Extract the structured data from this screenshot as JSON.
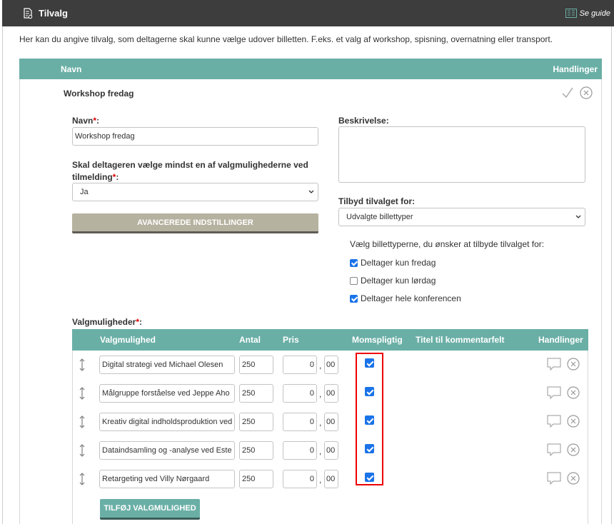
{
  "header": {
    "title": "Tilvalg",
    "guide_label": "Se guide"
  },
  "intro": "Her kan du angive tilvalg, som deltagerne skal kunne vælge udover billetten. F.eks. et valg af workshop, spisning, overnatning eller transport.",
  "table": {
    "col_name": "Navn",
    "col_actions": "Handlinger"
  },
  "item": {
    "title": "Workshop fredag",
    "name_label": "Navn",
    "name_value": "Workshop fredag",
    "required_mark": "*",
    "mandatory_label": "Skal deltageren vælge mindst en af valgmulighederne ved tilmelding",
    "mandatory_value": "Ja",
    "advanced_button": "AVANCEREDE INDSTILLINGER",
    "description_label": "Beskrivelse:",
    "offer_label": "Tilbyd tilvalget for:",
    "offer_value": "Udvalgte billettyper",
    "ticket_hint": "Vælg billettyperne, du ønsker at tilbyde tilvalget for:",
    "ticket_types": [
      {
        "label": "Deltager kun fredag",
        "checked": true
      },
      {
        "label": "Deltager kun lørdag",
        "checked": false
      },
      {
        "label": "Deltager hele konferencen",
        "checked": true
      }
    ]
  },
  "options": {
    "label": "Valgmuligheder",
    "headers": {
      "name": "Valgmulighed",
      "antal": "Antal",
      "pris": "Pris",
      "moms": "Momspligtig",
      "comment": "Titel til kommentarfelt",
      "actions": "Handlinger"
    },
    "rows": [
      {
        "name": "Digital strategi ved Michael Olesen",
        "antal": "250",
        "pris": "0",
        "ore": "00",
        "moms": true
      },
      {
        "name": "Målgruppe forståelse ved Jeppe Aho",
        "antal": "250",
        "pris": "0",
        "ore": "00",
        "moms": true
      },
      {
        "name": "Kreativ digital indholdsproduktion ved",
        "antal": "250",
        "pris": "0",
        "ore": "00",
        "moms": true
      },
      {
        "name": "Dataindsamling og -analyse ved Este",
        "antal": "250",
        "pris": "0",
        "ore": "00",
        "moms": true
      },
      {
        "name": "Retargeting ved Villy Nørgaard",
        "antal": "250",
        "pris": "0",
        "ore": "00",
        "moms": true
      }
    ],
    "add_button": "TILFØJ VALGMULIGHED"
  },
  "colors": {
    "header_bg": "#3d3d3d",
    "accent_teal": "#6aafa6",
    "highlight": "#e00000",
    "checkbox_blue": "#1a73e8"
  }
}
